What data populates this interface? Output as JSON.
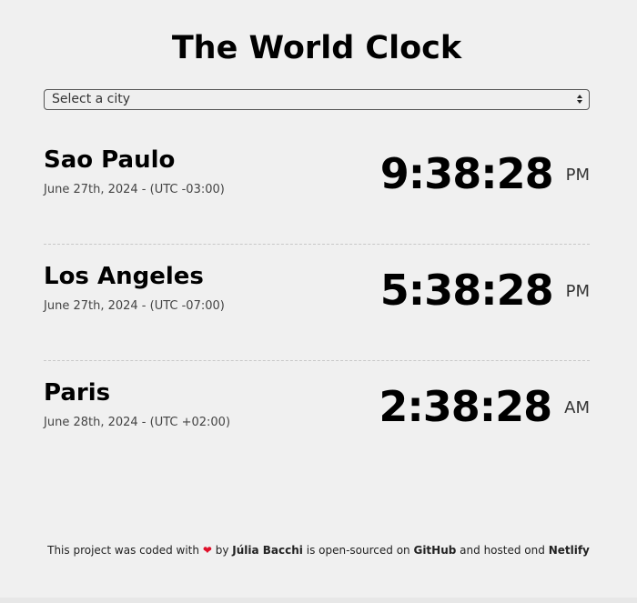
{
  "header": {
    "title": "The World Clock"
  },
  "city_select": {
    "selected": "Select a city"
  },
  "cities": [
    {
      "name": "Sao Paulo",
      "date": "June 27th, 2024 - (UTC -03:00)",
      "time": "9:38:28",
      "ampm": "PM"
    },
    {
      "name": "Los Angeles",
      "date": "June 27th, 2024 - (UTC -07:00)",
      "time": "5:38:28",
      "ampm": "PM"
    },
    {
      "name": "Paris",
      "date": "June 28th, 2024 - (UTC +02:00)",
      "time": "2:38:28",
      "ampm": "AM"
    }
  ],
  "footer": {
    "text_before": "This project was coded with",
    "heart": "❤",
    "by": "by",
    "author": "Júlia Bacchi",
    "middle": "is open-sourced on",
    "github": "GitHub",
    "hosted": "and hosted ond",
    "netlify": "Netlify",
    "heart_color": "#e0102a"
  }
}
